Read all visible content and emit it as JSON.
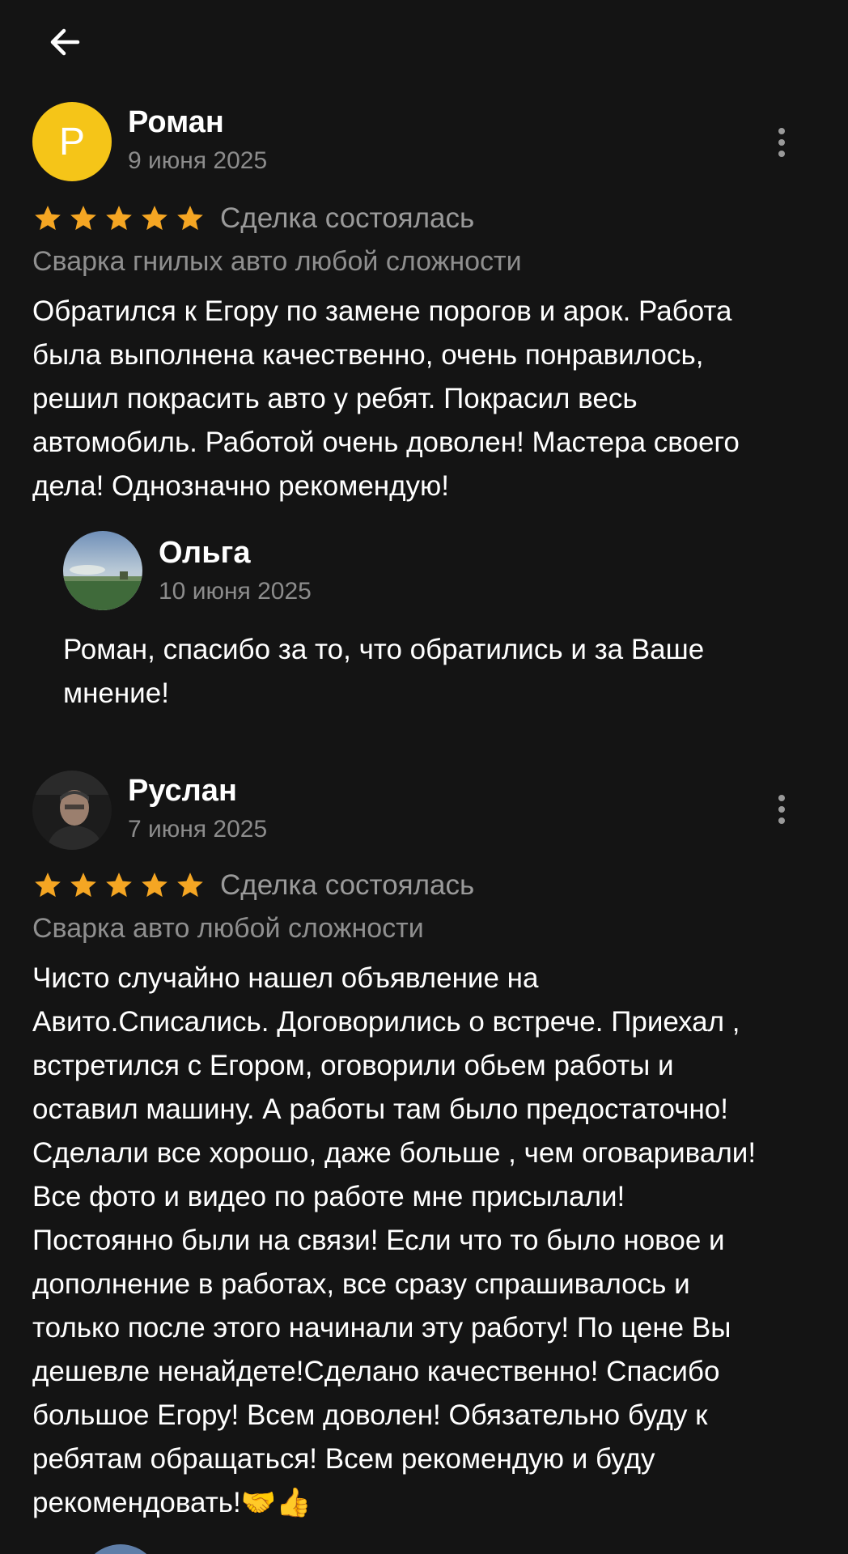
{
  "nav": {
    "back_icon": "arrow-left-icon"
  },
  "reviews": [
    {
      "author": "Роман",
      "avatar_letter": "Р",
      "avatar_color": "#f5c518",
      "date": "9 июня 2025",
      "rating": 5,
      "deal_status": "Сделка состоялась",
      "service": "Сварка гнилых авто любой сложности",
      "text_lines": [
        "Обратился к Егору по замене порогов и арок. Работа",
        "была выполнена  качественно, очень понравилось,",
        "решил покрасить авто у ребят. Покрасил весь",
        "автомобиль. Работой очень доволен! Мастера своего",
        "дела! Однозначно рекомендую!"
      ],
      "reply": {
        "author": "Ольга",
        "date": "10 июня 2025",
        "text_lines": [
          "Роман, спасибо за то, что обратились и за Ваше",
          "мнение!"
        ]
      }
    },
    {
      "author": "Руслан",
      "date": "7 июня 2025",
      "rating": 5,
      "deal_status": "Сделка состоялась",
      "service": "Сварка авто любой сложности",
      "text_lines": [
        "Чисто случайно нашел объявление на",
        "Авито.Списались. Договорились о встрече. Приехал ,",
        "встретился с Егором, оговорили обьем работы и",
        "оставил машину. А работы там было предостаточно!",
        "Сделали все хорошо, даже больше , чем оговаривали!",
        "Все фото и видео по работе мне присылали!",
        "Постоянно были на связи! Если что то было новое и",
        "дополнение в работах, все сразу спрашивалось и",
        "только после этого начинали эту работу! По цене Вы",
        "дешевле ненайдете!Сделано качественно! Спасибо",
        "большое Егору! Всем доволен! Обязательно буду к",
        "ребятам обращаться! Всем рекомендую и  буду",
        "рекомендовать!🤝👍"
      ]
    }
  ],
  "colors": {
    "background": "#141414",
    "star": "#f5a623",
    "secondary_text": "#8c8c8c"
  }
}
